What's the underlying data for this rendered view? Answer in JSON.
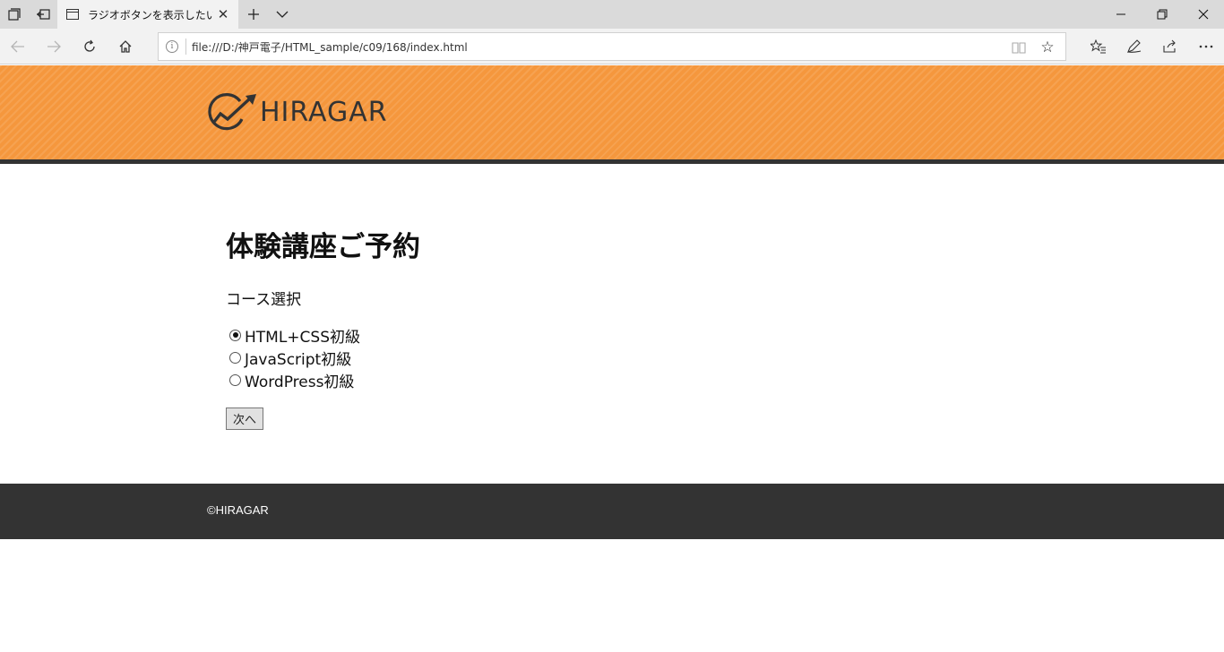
{
  "browser": {
    "tab": {
      "title": "ラジオボタンを表示したい"
    },
    "address": {
      "url": "file:///D:/神戸電子/HTML_sample/c09/168/index.html"
    }
  },
  "site": {
    "logo_text": "HIRAGAR",
    "brand_color": "#f5973d",
    "dark_color": "#333333",
    "footer_text": "©HIRAGAR"
  },
  "form": {
    "title": "体験講座ご予約",
    "section_label": "コース選択",
    "options": [
      {
        "label": "HTML+CSS初級",
        "checked": true
      },
      {
        "label": "JavaScript初級",
        "checked": false
      },
      {
        "label": "WordPress初級",
        "checked": false
      }
    ],
    "submit_label": "次へ"
  }
}
